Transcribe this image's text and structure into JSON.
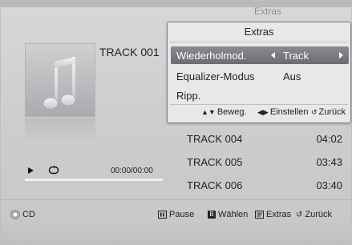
{
  "background_title": "Extras",
  "now_playing": {
    "track_title": "TRACK 001",
    "time": "00:00/00:00",
    "progress": 0
  },
  "tracks": [
    {
      "name": "TRACK 004",
      "duration": "04:02"
    },
    {
      "name": "TRACK 005",
      "duration": "03:43"
    },
    {
      "name": "TRACK 006",
      "duration": "03:40"
    }
  ],
  "extras_popup": {
    "title": "Extras",
    "items": [
      {
        "label": "Wiederholmod.",
        "value": "Track",
        "selected": true
      },
      {
        "label": "Equalizer-Modus",
        "value": "Aus",
        "selected": false
      },
      {
        "label": "Ripp.",
        "value": "",
        "selected": false
      }
    ],
    "help": [
      {
        "glyph": "▲▼",
        "label": "Beweg."
      },
      {
        "glyph": "◀▶",
        "label": "Einstellen"
      },
      {
        "glyph": "↺",
        "label": "Zurück"
      }
    ]
  },
  "bottom_bar": {
    "source": "CD",
    "pause": "Pause",
    "select_key": "B",
    "select": "Wählen",
    "extras": "Extras",
    "back": "Zurück"
  },
  "colors": {
    "background": "#cdced0",
    "popup_bg": "#e8e8ea",
    "selected_row": "#7a7c7f"
  }
}
